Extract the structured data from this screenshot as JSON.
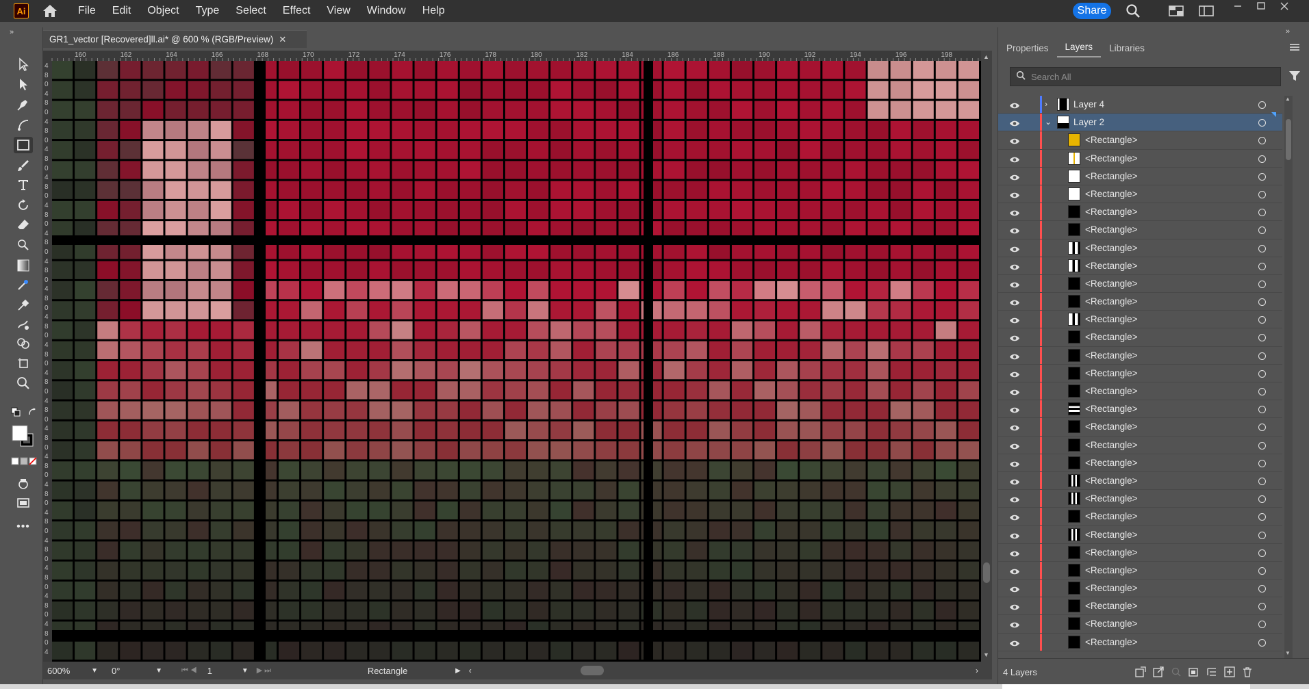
{
  "app": {
    "logo_text": "Ai"
  },
  "menu": {
    "items": [
      "File",
      "Edit",
      "Object",
      "Type",
      "Select",
      "Effect",
      "View",
      "Window",
      "Help"
    ],
    "share_label": "Share"
  },
  "document": {
    "tab_title": "GR1_vector [Recovered]ll.ai* @ 600 % (RGB/Preview)",
    "close_glyph": "✕"
  },
  "ruler": {
    "top_labels": [
      "160",
      "162",
      "164",
      "166",
      "168",
      "170",
      "172",
      "174",
      "176",
      "178",
      "180",
      "182",
      "184",
      "186",
      "188",
      "190",
      "192",
      "194",
      "196",
      "198"
    ],
    "left_digits": [
      "4",
      "8",
      "0",
      "4",
      "8",
      "0",
      "4",
      "8",
      "0",
      "4",
      "8",
      "0",
      "4",
      "8",
      "0",
      "4",
      "8",
      "0",
      "4",
      "8",
      "0",
      "4",
      "8",
      "0",
      "4",
      "8",
      "0",
      "4",
      "8",
      "0",
      "4",
      "8",
      "0",
      "4",
      "8",
      "0",
      "4",
      "8",
      "0",
      "4",
      "8",
      "0",
      "4",
      "8",
      "0",
      "4",
      "8",
      "0",
      "4",
      "8",
      "0",
      "4",
      "8",
      "0",
      "4",
      "8",
      "0",
      "4",
      "8",
      "0",
      "4",
      "8",
      "0",
      "4"
    ]
  },
  "statusbar": {
    "zoom": "600%",
    "rotation": "0°",
    "artboard": "1",
    "selection_label": "Rectangle"
  },
  "panel": {
    "tabs": [
      {
        "label": "Properties",
        "active": false
      },
      {
        "label": "Layers",
        "active": true
      },
      {
        "label": "Libraries",
        "active": false
      }
    ],
    "search_placeholder": "Search All",
    "layer_count": "4 Layers",
    "layers": [
      {
        "name": "Layer 4",
        "level": 0,
        "expanded": false,
        "selected": false,
        "color": "#4f7bff",
        "thumb": "split-black"
      },
      {
        "name": "Layer 2",
        "level": 0,
        "expanded": true,
        "selected": true,
        "color": "#ff4f4f",
        "thumb": "white-black"
      },
      {
        "name": "<Rectangle>",
        "level": 1,
        "thumb": "yellow"
      },
      {
        "name": "<Rectangle>",
        "level": 1,
        "thumb": "yellow-white"
      },
      {
        "name": "<Rectangle>",
        "level": 1,
        "thumb": "white"
      },
      {
        "name": "<Rectangle>",
        "level": 1,
        "thumb": "white"
      },
      {
        "name": "<Rectangle>",
        "level": 1,
        "thumb": "black"
      },
      {
        "name": "<Rectangle>",
        "level": 1,
        "thumb": "black"
      },
      {
        "name": "<Rectangle>",
        "level": 1,
        "thumb": "white-bars"
      },
      {
        "name": "<Rectangle>",
        "level": 1,
        "thumb": "white-bars"
      },
      {
        "name": "<Rectangle>",
        "level": 1,
        "thumb": "black"
      },
      {
        "name": "<Rectangle>",
        "level": 1,
        "thumb": "black"
      },
      {
        "name": "<Rectangle>",
        "level": 1,
        "thumb": "white-bars"
      },
      {
        "name": "<Rectangle>",
        "level": 1,
        "thumb": "black"
      },
      {
        "name": "<Rectangle>",
        "level": 1,
        "thumb": "black"
      },
      {
        "name": "<Rectangle>",
        "level": 1,
        "thumb": "black"
      },
      {
        "name": "<Rectangle>",
        "level": 1,
        "thumb": "black"
      },
      {
        "name": "<Rectangle>",
        "level": 1,
        "thumb": "hstripes"
      },
      {
        "name": "<Rectangle>",
        "level": 1,
        "thumb": "black"
      },
      {
        "name": "<Rectangle>",
        "level": 1,
        "thumb": "black"
      },
      {
        "name": "<Rectangle>",
        "level": 1,
        "thumb": "black"
      },
      {
        "name": "<Rectangle>",
        "level": 1,
        "thumb": "black-bar"
      },
      {
        "name": "<Rectangle>",
        "level": 1,
        "thumb": "black-bar"
      },
      {
        "name": "<Rectangle>",
        "level": 1,
        "thumb": "black"
      },
      {
        "name": "<Rectangle>",
        "level": 1,
        "thumb": "black-bar"
      },
      {
        "name": "<Rectangle>",
        "level": 1,
        "thumb": "black"
      },
      {
        "name": "<Rectangle>",
        "level": 1,
        "thumb": "black"
      },
      {
        "name": "<Rectangle>",
        "level": 1,
        "thumb": "black"
      },
      {
        "name": "<Rectangle>",
        "level": 1,
        "thumb": "black"
      },
      {
        "name": "<Rectangle>",
        "level": 1,
        "thumb": "black"
      },
      {
        "name": "<Rectangle>",
        "level": 1,
        "thumb": "black"
      }
    ]
  },
  "colors": {
    "accent": "#1473e6",
    "selection": "#46607e",
    "layer4_color": "#4f7bff",
    "layer2_color": "#ff4f4f"
  }
}
